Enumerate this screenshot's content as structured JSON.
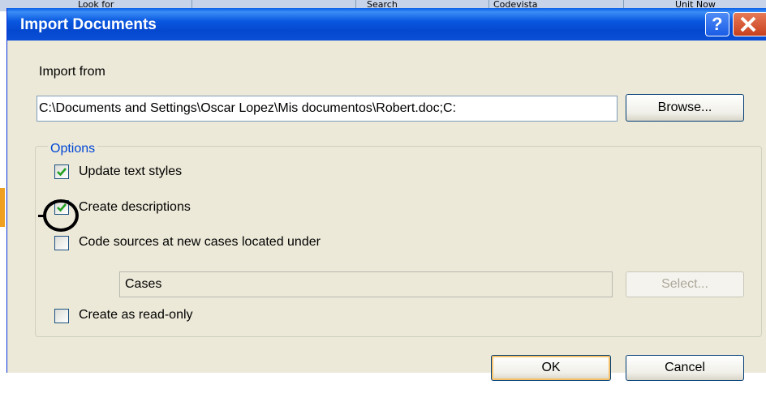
{
  "background": {
    "cells": [
      "Look for",
      "",
      "Search",
      "Codevista",
      "Unit Now"
    ]
  },
  "dialog": {
    "title": "Import Documents",
    "help_glyph": "?",
    "import_from_label": "Import from",
    "path_value": "C:\\Documents and Settings\\Oscar Lopez\\Mis documentos\\Robert.doc;C:",
    "browse_label": "Browse...",
    "options_label": "Options",
    "options": [
      {
        "label": "Update text styles",
        "checked": true
      },
      {
        "label": "Create descriptions",
        "checked": true
      },
      {
        "label": "Code sources at new cases located under",
        "checked": false
      },
      {
        "label": "Create as read-only",
        "checked": false
      }
    ],
    "cases_value": "Cases",
    "select_label": "Select...",
    "ok_label": "OK",
    "cancel_label": "Cancel"
  },
  "colors": {
    "title_bar": "#0a58e0",
    "dialog_face": "#ece9d8",
    "group_legend": "#0046d5",
    "check_mark": "#21a121",
    "annotation": "#000000"
  }
}
